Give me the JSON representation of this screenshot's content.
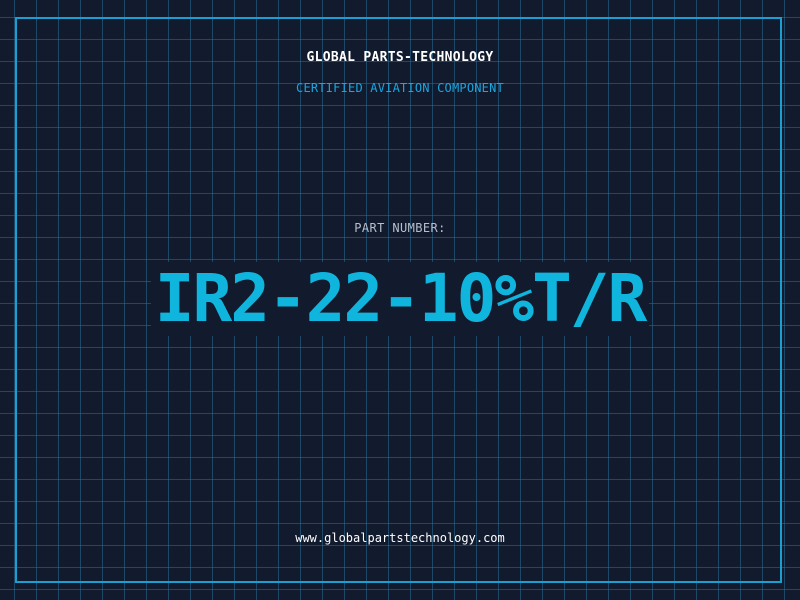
{
  "header": {
    "company": "GLOBAL PARTS-TECHNOLOGY",
    "subtitle": "CERTIFIED AVIATION COMPONENT"
  },
  "part": {
    "label": "PART NUMBER:",
    "number": "IR2-22-10%T/R"
  },
  "footer": {
    "website": "www.globalpartstechnology.com"
  },
  "colors": {
    "background": "#121a2e",
    "grid": "#286e96",
    "accent": "#1a9fd0",
    "part_number": "#10b5de",
    "label": "#b6bfcc",
    "title": "#ffffff"
  }
}
